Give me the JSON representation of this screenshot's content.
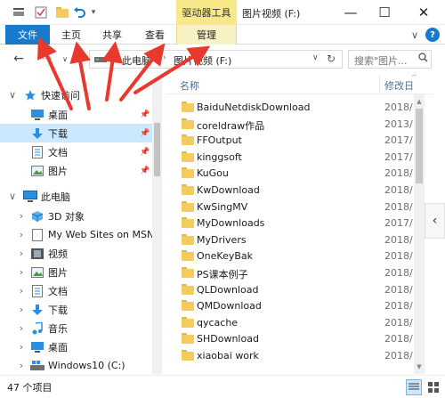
{
  "window": {
    "context_tab_label": "驱动器工具",
    "title": "图片视频 (F:)",
    "minimize_glyph": "—",
    "maximize_glyph": "☐",
    "close_glyph": "✕"
  },
  "ribbon": {
    "tabs": [
      {
        "label": "文件"
      },
      {
        "label": "主页"
      },
      {
        "label": "共享"
      },
      {
        "label": "查看"
      },
      {
        "label": "管理"
      }
    ],
    "collapse_glyph": "∨",
    "help_glyph": "?"
  },
  "address_bar": {
    "segments": [
      "此电脑",
      "图片视频 (F:)"
    ],
    "search_placeholder": "搜索\"图片...",
    "refresh_glyph": "↻",
    "dropdown_glyph": "∨"
  },
  "nav_pane": {
    "quick_access": {
      "label": "快速访问",
      "icon": "star-icon"
    },
    "quick_items": [
      {
        "label": "桌面",
        "icon": "desktop-icon",
        "pinned": true
      },
      {
        "label": "下载",
        "icon": "download-icon",
        "pinned": true,
        "selected": true
      },
      {
        "label": "文档",
        "icon": "document-icon",
        "pinned": true
      },
      {
        "label": "图片",
        "icon": "pictures-icon",
        "pinned": true
      }
    ],
    "this_pc": {
      "label": "此电脑",
      "icon": "computer-icon"
    },
    "pc_items": [
      {
        "label": "3D 对象",
        "icon": "cube-3d-icon"
      },
      {
        "label": "My Web Sites on MSN",
        "icon": "web-page-icon"
      },
      {
        "label": "视频",
        "icon": "video-icon"
      },
      {
        "label": "图片",
        "icon": "pictures-icon"
      },
      {
        "label": "文档",
        "icon": "document-icon"
      },
      {
        "label": "下载",
        "icon": "download-icon"
      },
      {
        "label": "音乐",
        "icon": "music-icon"
      },
      {
        "label": "桌面",
        "icon": "desktop-icon"
      },
      {
        "label": "Windows10 (C:)",
        "icon": "windows-drive-icon"
      }
    ]
  },
  "file_list": {
    "columns": {
      "name": "名称",
      "modified": "修改日"
    },
    "rows": [
      {
        "name": "BaiduNetdiskDownload",
        "date": "2018/"
      },
      {
        "name": "coreldraw作品",
        "date": "2013/"
      },
      {
        "name": "FFOutput",
        "date": "2017/"
      },
      {
        "name": "kinggsoft",
        "date": "2017/"
      },
      {
        "name": "KuGou",
        "date": "2018/"
      },
      {
        "name": "KwDownload",
        "date": "2018/"
      },
      {
        "name": "KwSingMV",
        "date": "2018/"
      },
      {
        "name": "MyDownloads",
        "date": "2017/"
      },
      {
        "name": "MyDrivers",
        "date": "2018/"
      },
      {
        "name": "OneKeyBak",
        "date": "2018/"
      },
      {
        "name": "PS课本例子",
        "date": "2018/"
      },
      {
        "name": "QLDownload",
        "date": "2018/"
      },
      {
        "name": "QMDownload",
        "date": "2018/"
      },
      {
        "name": "qycache",
        "date": "2018/"
      },
      {
        "name": "SHDownload",
        "date": "2018/"
      },
      {
        "name": "xiaobai work",
        "date": "2018/"
      }
    ]
  },
  "status_bar": {
    "item_count": "47 个项目"
  },
  "colors": {
    "accent": "#1979ca",
    "context_tab": "#f7e88a",
    "annotation": "#e8392f"
  }
}
